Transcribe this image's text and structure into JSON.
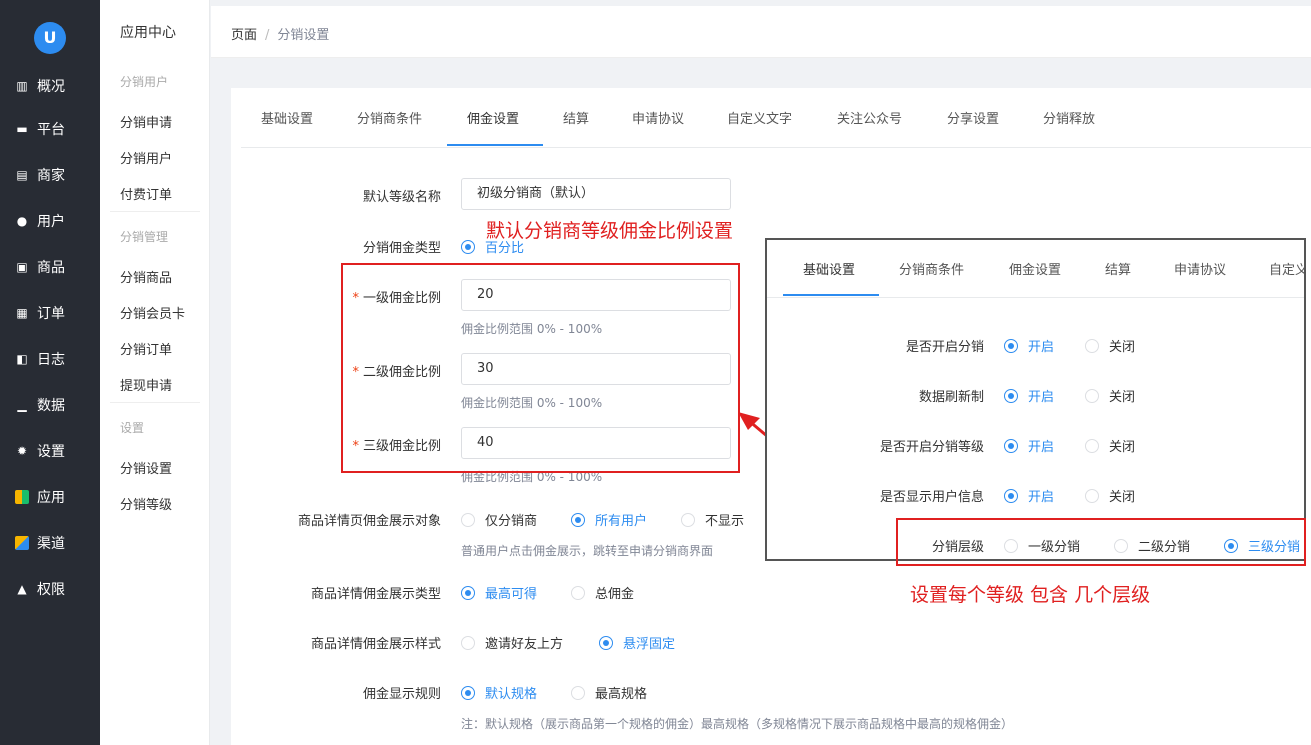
{
  "sidebar": {
    "logo": "U",
    "items": [
      {
        "label": "概况",
        "icon": "chart-icon"
      },
      {
        "label": "平台",
        "icon": "monitor-icon"
      },
      {
        "label": "商家",
        "icon": "store-icon"
      },
      {
        "label": "用户",
        "icon": "user-icon"
      },
      {
        "label": "商品",
        "icon": "goods-icon"
      },
      {
        "label": "订单",
        "icon": "order-icon"
      },
      {
        "label": "日志",
        "icon": "log-icon"
      },
      {
        "label": "数据",
        "icon": "bar-chart-icon"
      },
      {
        "label": "设置",
        "icon": "gear-icon"
      },
      {
        "label": "应用",
        "icon": "apps-icon"
      },
      {
        "label": "渠道",
        "icon": "channel-icon"
      },
      {
        "label": "权限",
        "icon": "lock-icon"
      }
    ]
  },
  "subnav": {
    "title": "应用中心",
    "groups": [
      {
        "name": "分销用户",
        "items": [
          "分销申请",
          "分销用户",
          "付费订单"
        ]
      },
      {
        "name": "分销管理",
        "items": [
          "分销商品",
          "分销会员卡",
          "分销订单",
          "提现申请"
        ]
      },
      {
        "name": "设置",
        "items": [
          "分销设置",
          "分销等级"
        ]
      }
    ]
  },
  "breadcrumb": {
    "root": "页面",
    "sep": "/",
    "current": "分销设置"
  },
  "tabs": [
    "基础设置",
    "分销商条件",
    "佣金设置",
    "结算",
    "申请协议",
    "自定义文字",
    "关注公众号",
    "分享设置",
    "分销释放"
  ],
  "active_tab": "佣金设置",
  "form": {
    "default_level_label": "默认等级名称",
    "default_level_value": "初级分销商（默认）",
    "commission_type_label": "分销佣金类型",
    "commission_type_option": "百分比",
    "level1_label": "一级佣金比例",
    "level1_value": "20",
    "level2_label": "二级佣金比例",
    "level2_value": "30",
    "level3_label": "三级佣金比例",
    "level3_value": "40",
    "ratio_hint": "佣金比例范围 0% - 100%",
    "required_mark": "*",
    "display_target_label": "商品详情页佣金展示对象",
    "display_target_options": [
      "仅分销商",
      "所有用户",
      "不显示"
    ],
    "display_target_hint": "普通用户点击佣金展示，跳转至申请分销商界面",
    "display_type_label": "商品详情佣金展示类型",
    "display_type_options": [
      "最高可得",
      "总佣金"
    ],
    "display_style_label": "商品详情佣金展示样式",
    "display_style_options": [
      "邀请好友上方",
      "悬浮固定"
    ],
    "display_rule_label": "佣金显示规则",
    "display_rule_options": [
      "默认规格",
      "最高规格"
    ],
    "display_rule_hint": "注：默认规格（展示商品第一个规格的佣金）最高规格（多规格情况下展示商品规格中最高的规格佣金）"
  },
  "annotations": {
    "top": "默认分销商等级佣金比例设置",
    "bottom": "设置每个等级 包含 几个层级",
    "color": "#e02020"
  },
  "inset": {
    "tabs": [
      "基础设置",
      "分销商条件",
      "佣金设置",
      "结算",
      "申请协议",
      "自定义"
    ],
    "rows": [
      {
        "label": "是否开启分销",
        "options": [
          "开启",
          "关闭"
        ]
      },
      {
        "label": "数据刷新制",
        "options": [
          "开启",
          "关闭"
        ]
      },
      {
        "label": "是否开启分销等级",
        "options": [
          "开启",
          "关闭"
        ]
      },
      {
        "label": "是否显示用户信息",
        "options": [
          "开启",
          "关闭"
        ]
      }
    ],
    "level_label": "分销层级",
    "level_options": [
      "一级分销",
      "二级分销",
      "三级分销"
    ]
  },
  "colors": {
    "primary": "#2d8cf0",
    "sidebar": "#282c34",
    "annotation": "#e02020"
  }
}
